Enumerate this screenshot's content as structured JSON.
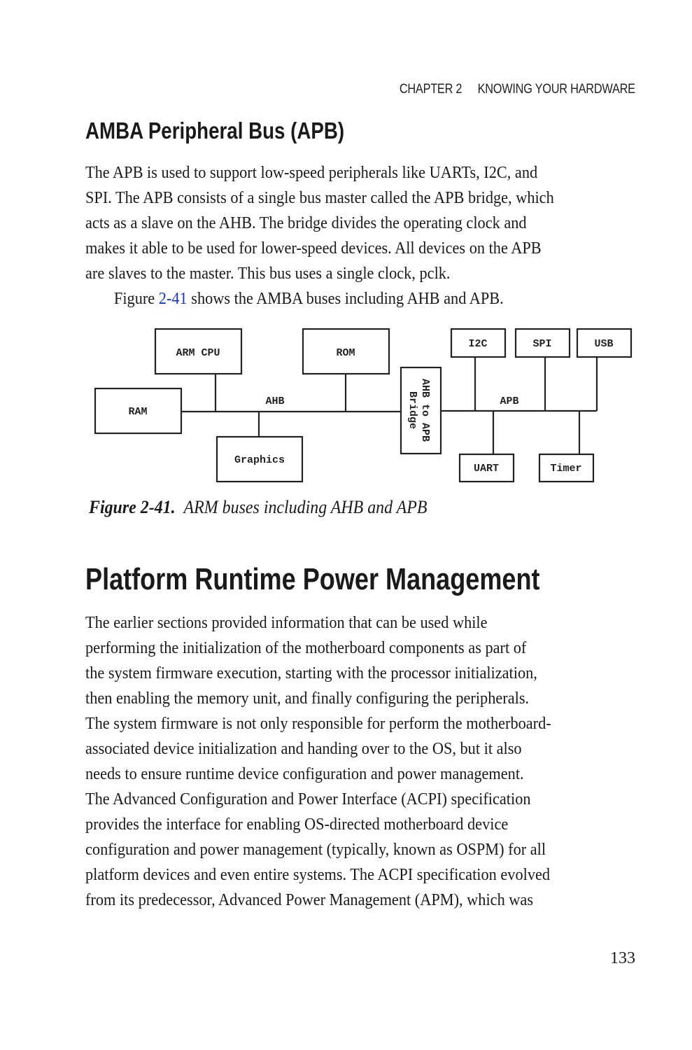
{
  "running_head": {
    "chapter": "CHAPTER 2",
    "title": "KNOWING YOUR HARDWARE"
  },
  "section": {
    "heading": "AMBA Peripheral Bus (APB)",
    "paragraph_lines": [
      "The APB is used to support low-speed peripherals like UARTs, I2C, and",
      "SPI. The APB consists of a single bus master called the APB bridge, which",
      "acts as a slave on the AHB. The bridge divides the operating clock and",
      "makes it able to be used for lower-speed devices. All devices on the APB",
      "are slaves to the master. This bus uses a single clock, pclk."
    ],
    "figure_ref": {
      "before": "Figure ",
      "link": "2-41",
      "after": " shows the AMBA buses including AHB and APB."
    }
  },
  "figure": {
    "labels": {
      "arm_cpu": "ARM CPU",
      "rom": "ROM",
      "ram": "RAM",
      "graphics": "Graphics",
      "ahb": "AHB",
      "bridge_line1": "AHB to APB",
      "bridge_line2": "Bridge",
      "apb": "APB",
      "i2c": "I2C",
      "spi": "SPI",
      "usb": "USB",
      "uart": "UART",
      "timer": "Timer"
    },
    "caption": {
      "number": "Figure 2-41.",
      "text": "ARM buses including AHB and APB"
    }
  },
  "chapter_section": {
    "heading": "Platform Runtime Power Management",
    "paragraph_lines": [
      "The earlier sections provided information that can be used while",
      "performing the initialization of the motherboard components as part of",
      "the system firmware execution, starting with the processor initialization,",
      "then enabling the memory unit, and finally configuring the peripherals.",
      "The system firmware is not only responsible for perform the motherboard-",
      "associated device initialization and handing over to the OS, but it also",
      "needs to ensure runtime device configuration and power management.",
      "The Advanced Configuration and Power Interface (ACPI) specification",
      "provides the interface for enabling OS-directed motherboard device",
      "configuration and power management (typically, known as OSPM) for all",
      "platform devices and even entire systems. The ACPI specification evolved",
      "from its predecessor, Advanced Power Management (APM), which was"
    ]
  },
  "page_number": "133"
}
